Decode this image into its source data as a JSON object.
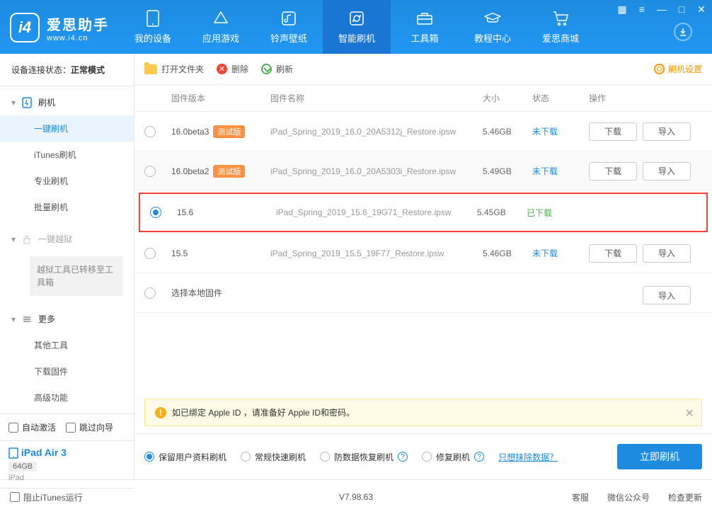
{
  "logo": {
    "title": "爱思助手",
    "sub": "www.i4.cn"
  },
  "main_tabs": [
    {
      "label": "我的设备"
    },
    {
      "label": "应用游戏"
    },
    {
      "label": "铃声壁纸"
    },
    {
      "label": "智能刷机"
    },
    {
      "label": "工具箱"
    },
    {
      "label": "教程中心"
    },
    {
      "label": "爱思商城"
    }
  ],
  "sidebar": {
    "status_label": "设备连接状态：",
    "status_value": "正常模式",
    "flash_header": "刷机",
    "items": [
      "一键刷机",
      "iTunes刷机",
      "专业刷机",
      "批量刷机"
    ],
    "jailbreak_header": "一键越狱",
    "jailbreak_note": "越狱工具已转移至工具箱",
    "more_header": "更多",
    "more_items": [
      "其他工具",
      "下载固件",
      "高级功能"
    ],
    "auto_activate": "自动激活",
    "skip_guide": "跳过向导",
    "device_name": "iPad Air 3",
    "device_cap": "64GB",
    "device_type": "iPad"
  },
  "toolbar": {
    "open": "打开文件夹",
    "delete": "删除",
    "refresh": "刷新",
    "settings": "刷机设置"
  },
  "table": {
    "headers": {
      "version": "固件版本",
      "name": "固件名称",
      "size": "大小",
      "status": "状态",
      "action": "操作"
    },
    "beta_label": "测试版",
    "download": "下载",
    "import": "导入",
    "local_fw": "选择本地固件",
    "rows": [
      {
        "ver": "16.0beta3",
        "beta": true,
        "name": "iPad_Spring_2019_16.0_20A5312j_Restore.ipsw",
        "size": "5.46GB",
        "status": "未下载",
        "done": false
      },
      {
        "ver": "16.0beta2",
        "beta": true,
        "name": "iPad_Spring_2019_16.0_20A5303i_Restore.ipsw",
        "size": "5.49GB",
        "status": "未下载",
        "done": false
      },
      {
        "ver": "15.6",
        "beta": false,
        "name": "iPad_Spring_2019_15.6_19G71_Restore.ipsw",
        "size": "5.45GB",
        "status": "已下载",
        "done": true
      },
      {
        "ver": "15.5",
        "beta": false,
        "name": "iPad_Spring_2019_15.5_19F77_Restore.ipsw",
        "size": "5.46GB",
        "status": "未下载",
        "done": false
      }
    ]
  },
  "alert": "如已绑定 Apple ID ，请准备好 Apple ID和密码。",
  "options": {
    "keep_data": "保留用户资料刷机",
    "normal": "常规快速刷机",
    "recovery": "防数据恢复刷机",
    "repair": "修复刷机",
    "erase_link": "只想抹除数据？",
    "primary": "立即刷机"
  },
  "statusbar": {
    "block_itunes": "阻止iTunes运行",
    "version": "V7.98.63",
    "support": "客服",
    "wechat": "微信公众号",
    "update": "检查更新"
  }
}
